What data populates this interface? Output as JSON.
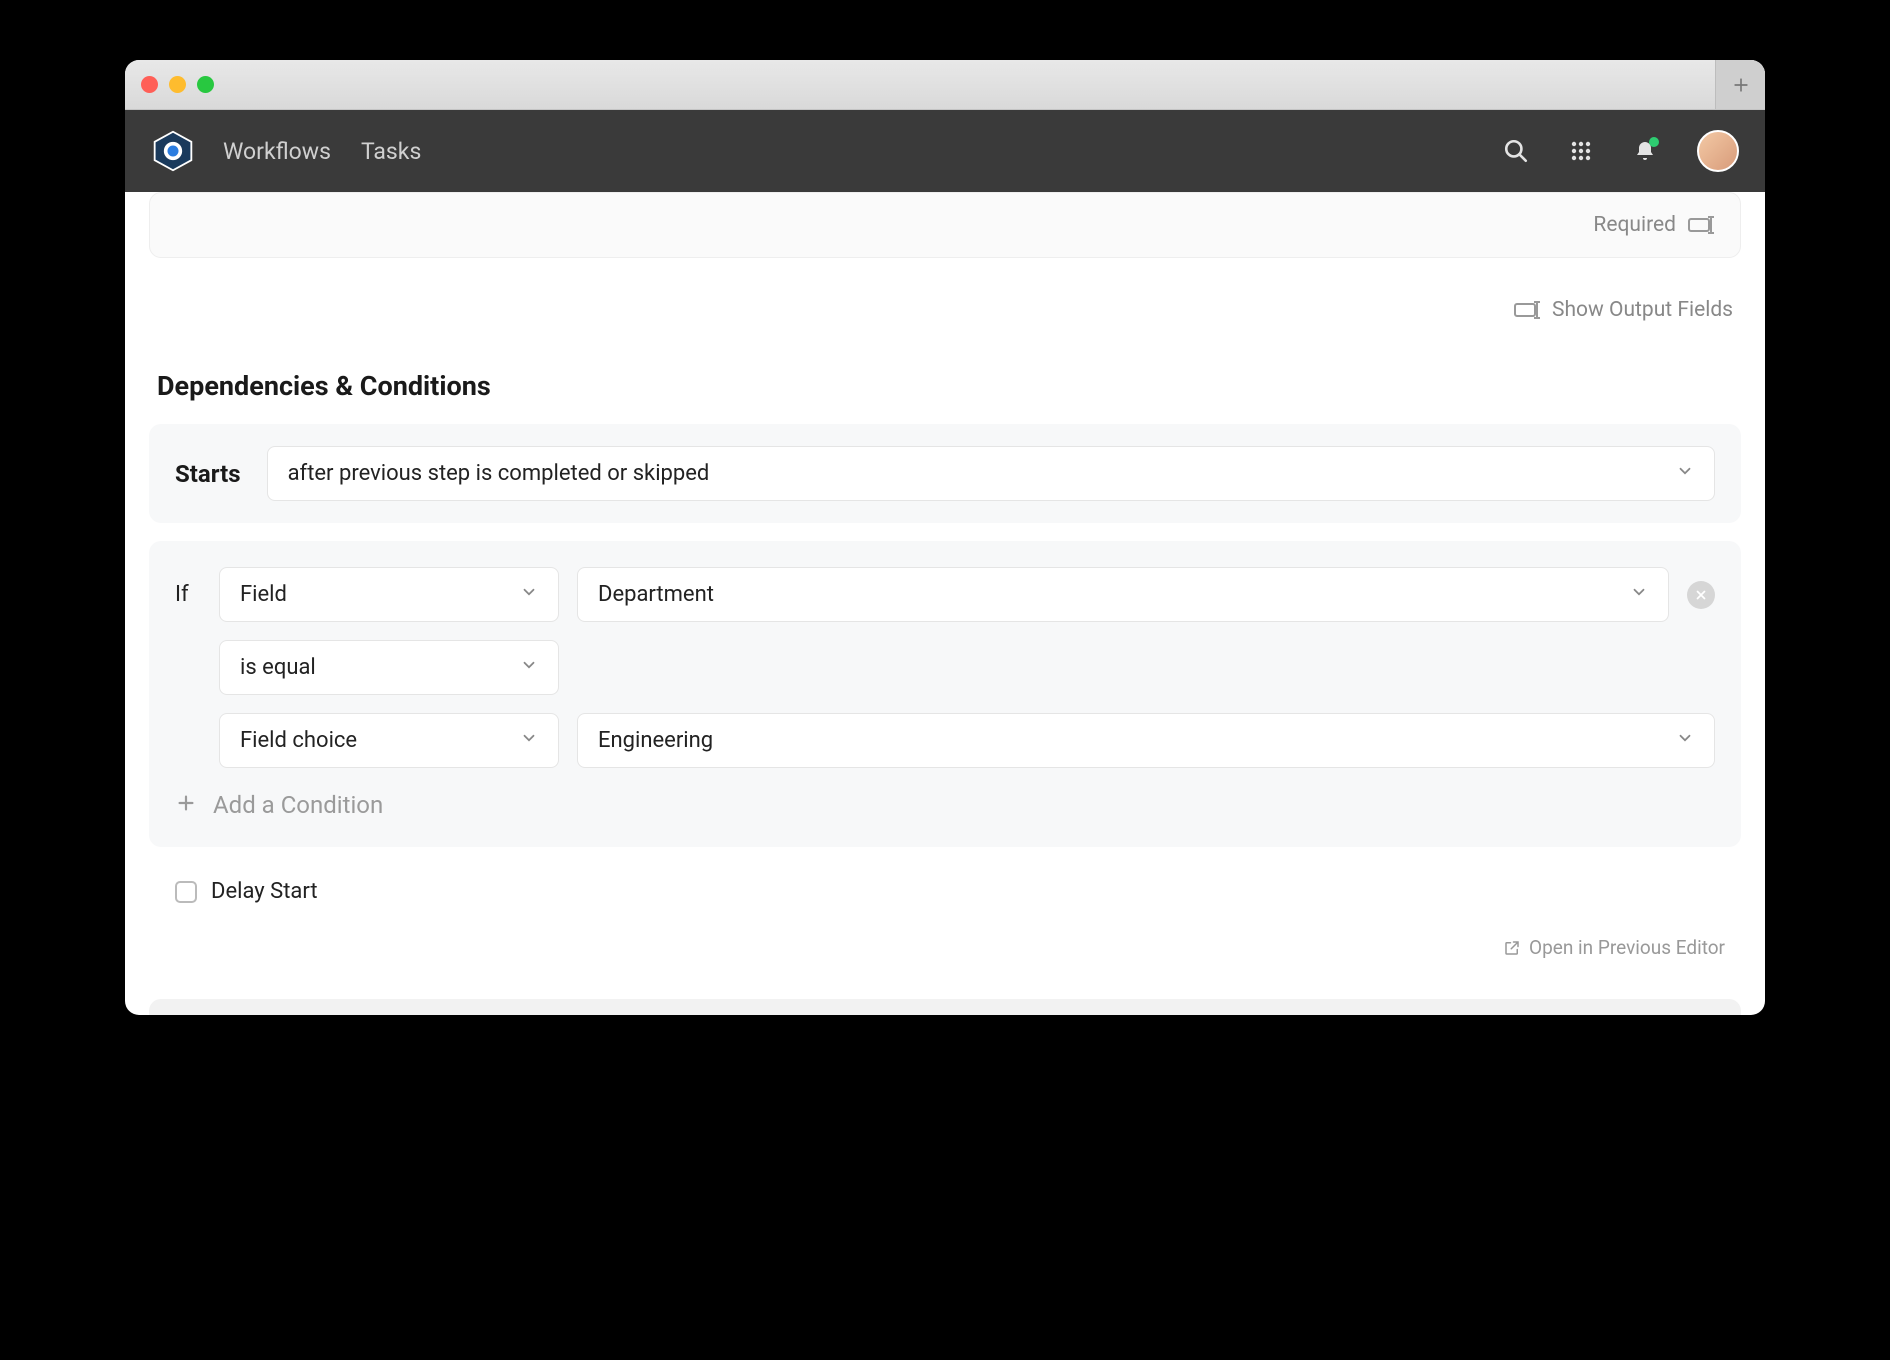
{
  "nav": {
    "workflows": "Workflows",
    "tasks": "Tasks"
  },
  "topcard": {
    "required": "Required"
  },
  "output": {
    "show": "Show Output Fields"
  },
  "section": {
    "title": "Dependencies & Conditions"
  },
  "starts": {
    "label": "Starts",
    "value": "after previous step is completed or skipped"
  },
  "cond": {
    "if": "If",
    "type": "Field",
    "field": "Department",
    "op": "is equal",
    "valtype": "Field choice",
    "value": "Engineering",
    "add": "Add a Condition"
  },
  "delay": {
    "label": "Delay Start"
  },
  "footer": {
    "open_prev": "Open in Previous Editor"
  }
}
